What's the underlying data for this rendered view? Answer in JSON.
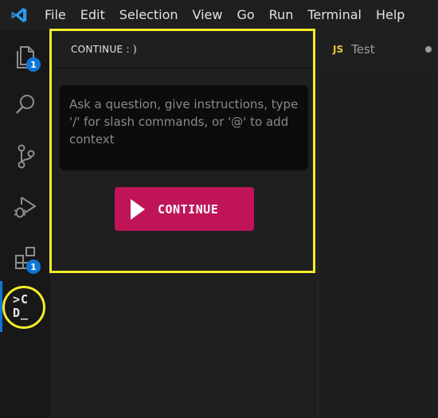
{
  "menubar": {
    "items": [
      "File",
      "Edit",
      "Selection",
      "View",
      "Go",
      "Run",
      "Terminal",
      "Help"
    ]
  },
  "activity_bar": {
    "explorer_badge": "1",
    "extensions_badge": "1",
    "continue_logo_text": ">C\nD_"
  },
  "panel": {
    "title": "CONTINUE : )",
    "input_placeholder": "Ask a question, give instructions, type '/' for slash commands, or '@' to add context",
    "button_label": "CONTINUE"
  },
  "editor": {
    "tab_icon": "JS",
    "tab_label": "Test"
  },
  "colors": {
    "accent": "#0e76d6",
    "continue_button": "#bf1558",
    "highlight": "#f5ec2a"
  }
}
